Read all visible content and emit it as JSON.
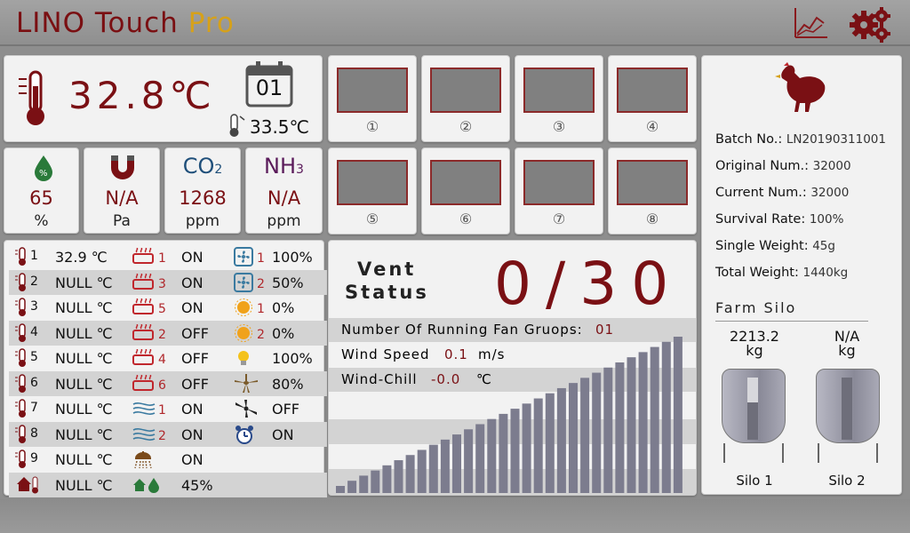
{
  "header": {
    "brand_lino": "LINO Touch",
    "brand_pro": "Pro",
    "chart_icon": "chart-icon",
    "settings_icon": "gear-icon"
  },
  "climate": {
    "indoor_temp": "32.8℃",
    "day": "01",
    "outdoor_temp": "33.5℃"
  },
  "sensors": [
    {
      "icon": "humidity-icon",
      "name": "",
      "value": "65",
      "unit": "%"
    },
    {
      "icon": "pressure-magnet-icon",
      "name": "",
      "value": "N/A",
      "unit": "Pa"
    },
    {
      "icon": "",
      "name": "CO",
      "sub": "2",
      "value": "1268",
      "unit": "ppm",
      "color": "#1f4f7a"
    },
    {
      "icon": "",
      "name": "NH",
      "sub": "3",
      "value": "N/A",
      "unit": "ppm",
      "color": "#5a1a5a"
    }
  ],
  "cameras": [
    "①",
    "②",
    "③",
    "④",
    "⑤",
    "⑥",
    "⑦",
    "⑧"
  ],
  "device_rows": [
    {
      "t_idx": "1",
      "temp": "32.9 ℃",
      "heater": "1",
      "h_state": "ON",
      "dev_icon": "fan-icon",
      "dev_num": "1",
      "dev_val": "100%"
    },
    {
      "t_idx": "2",
      "temp": "NULL ℃",
      "heater": "3",
      "h_state": "ON",
      "dev_icon": "fan-icon",
      "dev_num": "2",
      "dev_val": "50%"
    },
    {
      "t_idx": "3",
      "temp": "NULL ℃",
      "heater": "5",
      "h_state": "ON",
      "dev_icon": "sun-icon",
      "dev_num": "1",
      "dev_val": "0%"
    },
    {
      "t_idx": "4",
      "temp": "NULL ℃",
      "heater": "2",
      "h_state": "OFF",
      "dev_icon": "sun-icon",
      "dev_num": "2",
      "dev_val": "0%"
    },
    {
      "t_idx": "5",
      "temp": "NULL ℃",
      "heater": "4",
      "h_state": "OFF",
      "dev_icon": "bulb-icon",
      "dev_num": "",
      "dev_val": "100%"
    },
    {
      "t_idx": "6",
      "temp": "NULL ℃",
      "heater": "6",
      "h_state": "OFF",
      "dev_icon": "ceiling-fan-icon",
      "dev_num": "",
      "dev_val": "80%"
    },
    {
      "t_idx": "7",
      "temp": "NULL ℃",
      "heater": "1",
      "h_state": "ON",
      "dev_icon": "stir-fan-icon",
      "dev_num": "",
      "dev_val": "OFF"
    },
    {
      "t_idx": "8",
      "temp": "NULL ℃",
      "heater": "2",
      "h_state": "ON",
      "dev_icon": "alarm-clock-icon",
      "dev_num": "",
      "dev_val": "ON"
    },
    {
      "t_idx": "9",
      "temp": "NULL ℃",
      "heater": "",
      "h_state": "ON",
      "dev_icon": "",
      "dev_num": "",
      "dev_val": ""
    },
    {
      "t_idx": "",
      "temp": "NULL ℃",
      "heater": "",
      "h_state": "45%",
      "dev_icon": "",
      "dev_num": "",
      "dev_val": ""
    }
  ],
  "vent": {
    "label_line1": "Vent",
    "label_line2": "Status",
    "value": "0/30",
    "fan_groups_label": "Number Of Running Fan Gruops:",
    "fan_groups_value": "01",
    "wind_speed_label": "Wind Speed",
    "wind_speed_value": "0.1",
    "wind_speed_unit": "m/s",
    "wind_chill_label": "Wind-Chill",
    "wind_chill_value": "-0.0",
    "wind_chill_unit": "℃",
    "bars_total": 30
  },
  "batch": {
    "icon": "hen-icon",
    "batch_label": "Batch No.:",
    "batch_value": "LN20190311001",
    "original_label": "Original Num.:",
    "original_value": "32000",
    "current_label": "Current Num.:",
    "current_value": "32000",
    "survival_label": "Survival Rate:",
    "survival_value": "100%",
    "single_label": "Single Weight:",
    "single_value": "45g",
    "total_label": "Total Weight:",
    "total_value": "1440kg"
  },
  "silo": {
    "title": "Farm Silo",
    "items": [
      {
        "value": "2213.2",
        "unit": "kg",
        "name": "Silo 1",
        "fill": 0.4
      },
      {
        "value": "N/A",
        "unit": "kg",
        "name": "Silo 2",
        "fill": 0
      }
    ]
  },
  "colors": {
    "accent": "#7a1014",
    "brand_pro": "#d6a11a",
    "bar": "#7c7c8e"
  }
}
